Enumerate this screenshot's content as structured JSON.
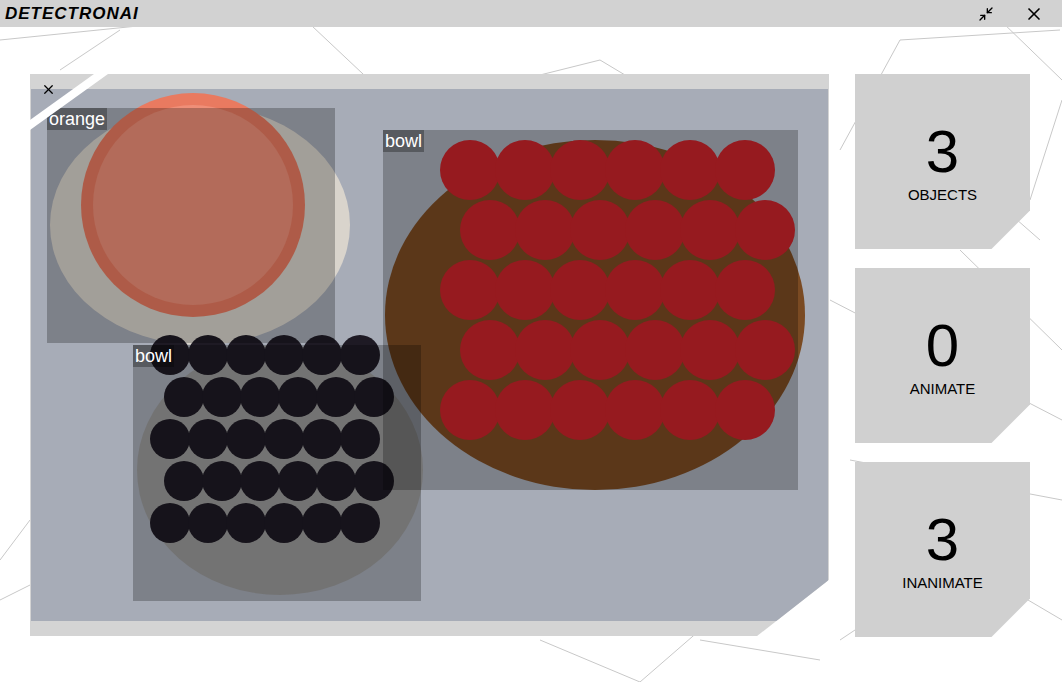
{
  "window": {
    "title": "DETECTRONAI"
  },
  "detections": [
    {
      "label": "orange"
    },
    {
      "label": "bowl"
    },
    {
      "label": "bowl"
    }
  ],
  "stats": [
    {
      "value": "3",
      "label": "OBJECTS"
    },
    {
      "value": "0",
      "label": "ANIMATE"
    },
    {
      "value": "3",
      "label": "INANIMATE"
    }
  ]
}
